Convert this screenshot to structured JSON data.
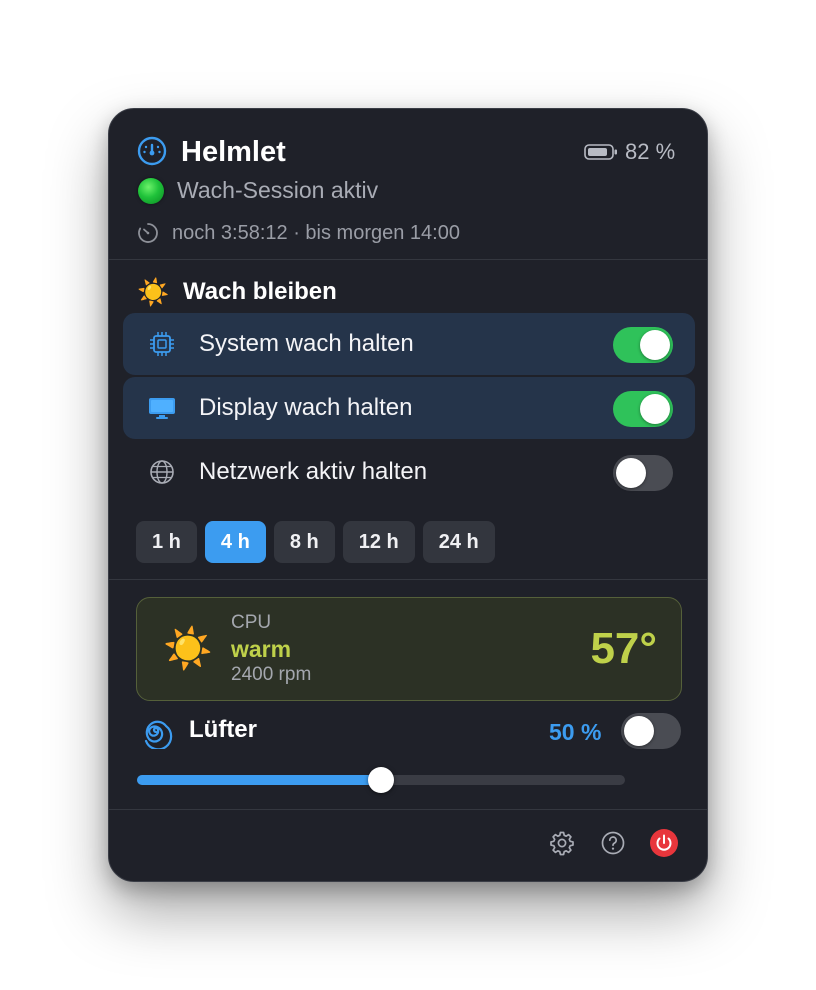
{
  "header": {
    "app_title": "Helmlet",
    "battery_percent": "82 %",
    "status_text": "Wach-Session aktiv",
    "timer_text": "noch 3:58:12 · bis morgen 14:00"
  },
  "awake": {
    "section_title": "Wach bleiben",
    "section_icon": "☀️",
    "rows": [
      {
        "label": "System wach halten",
        "icon": "cpu-icon",
        "enabled": true
      },
      {
        "label": "Display wach halten",
        "icon": "display-icon",
        "enabled": true
      },
      {
        "label": "Netzwerk aktiv halten",
        "icon": "globe-icon",
        "enabled": false
      }
    ],
    "durations": [
      "1 h",
      "4 h",
      "8 h",
      "12 h",
      "24 h"
    ],
    "selected_duration": "4 h"
  },
  "cpu": {
    "label": "CPU",
    "state": "warm",
    "rpm": "2400 rpm",
    "temperature": "57°",
    "icon": "☀️"
  },
  "fan": {
    "title": "Lüfter",
    "percent_label": "50 %",
    "level": 0.5,
    "manual_enabled": false
  },
  "colors": {
    "accent": "#3c9cf0",
    "toggle_on": "#2fc25a",
    "warm": "#bfd14a",
    "power": "#e8363c",
    "panel": "#1f2129"
  }
}
